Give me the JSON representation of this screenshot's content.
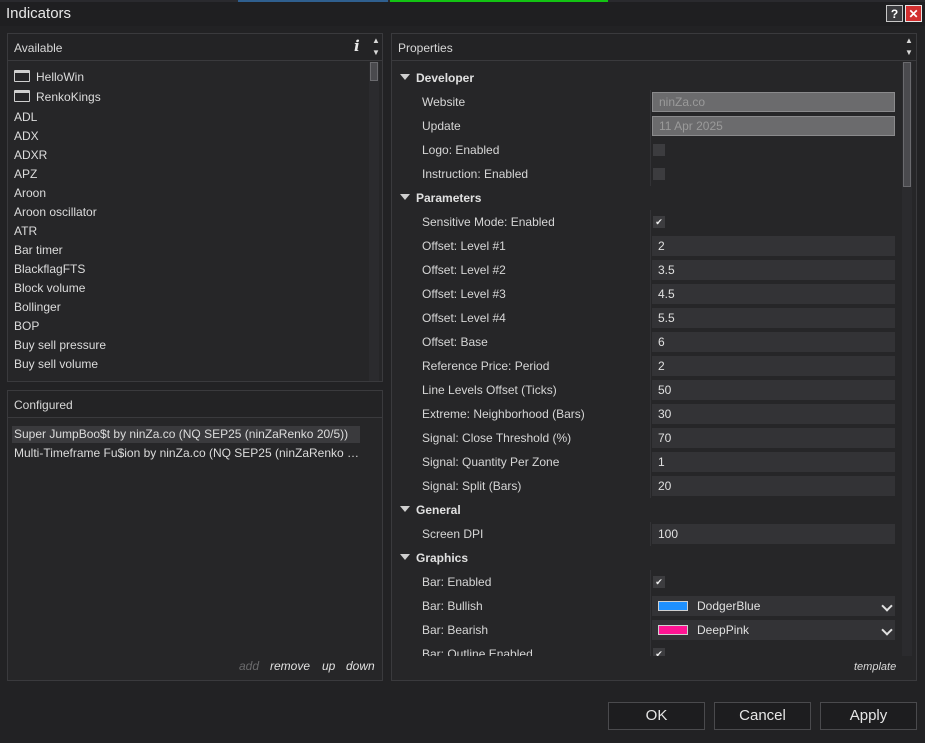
{
  "window": {
    "title": "Indicators",
    "help_label": "?",
    "close_label": "✕"
  },
  "available": {
    "header": "Available",
    "info_label": "i",
    "folders": [
      "HelloWin",
      "RenkoKings"
    ],
    "items": [
      "ADL",
      "ADX",
      "ADXR",
      "APZ",
      "Aroon",
      "Aroon oscillator",
      "ATR",
      "Bar timer",
      "BlackflagFTS",
      "Block volume",
      "Bollinger",
      "BOP",
      "Buy sell pressure",
      "Buy sell volume"
    ]
  },
  "configured": {
    "header": "Configured",
    "items": [
      "Super JumpBoo$t by ninZa.co (NQ SEP25 (ninZaRenko 20/5))",
      "Multi-Timeframe Fu$ion by ninZa.co (NQ SEP25 (ninZaRenko 2..."
    ],
    "actions": {
      "add": "add",
      "remove": "remove",
      "up": "up",
      "down": "down"
    }
  },
  "properties": {
    "header": "Properties",
    "categories": {
      "developer": "Developer",
      "parameters": "Parameters",
      "general": "General",
      "graphics": "Graphics"
    },
    "developer": {
      "website_label": "Website",
      "website_value": "ninZa.co",
      "update_label": "Update",
      "update_value": "11 Apr 2025",
      "logo_label": "Logo: Enabled",
      "instruction_label": "Instruction: Enabled"
    },
    "parameters": [
      {
        "label": "Sensitive Mode: Enabled",
        "checked": true
      },
      {
        "label": "Offset: Level #1",
        "value": "2"
      },
      {
        "label": "Offset: Level #2",
        "value": "3.5"
      },
      {
        "label": "Offset: Level #3",
        "value": "4.5"
      },
      {
        "label": "Offset: Level #4",
        "value": "5.5"
      },
      {
        "label": "Offset: Base",
        "value": "6"
      },
      {
        "label": "Reference Price: Period",
        "value": "2"
      },
      {
        "label": "Line Levels Offset (Ticks)",
        "value": "50"
      },
      {
        "label": "Extreme: Neighborhood (Bars)",
        "value": "30"
      },
      {
        "label": "Signal: Close Threshold (%)",
        "value": "70"
      },
      {
        "label": "Signal: Quantity Per Zone",
        "value": "1"
      },
      {
        "label": "Signal: Split (Bars)",
        "value": "20"
      }
    ],
    "general": {
      "screen_dpi_label": "Screen DPI",
      "screen_dpi_value": "100"
    },
    "graphics": {
      "bar_enabled_label": "Bar: Enabled",
      "bar_bullish_label": "Bar: Bullish",
      "bar_bullish_value": "DodgerBlue",
      "bar_bullish_color": "#1E90FF",
      "bar_bearish_label": "Bar: Bearish",
      "bar_bearish_value": "DeepPink",
      "bar_bearish_color": "#FF1493",
      "bar_outline_label": "Bar: Outline Enabled"
    },
    "template_label": "template"
  },
  "buttons": {
    "ok": "OK",
    "cancel": "Cancel",
    "apply": "Apply"
  }
}
